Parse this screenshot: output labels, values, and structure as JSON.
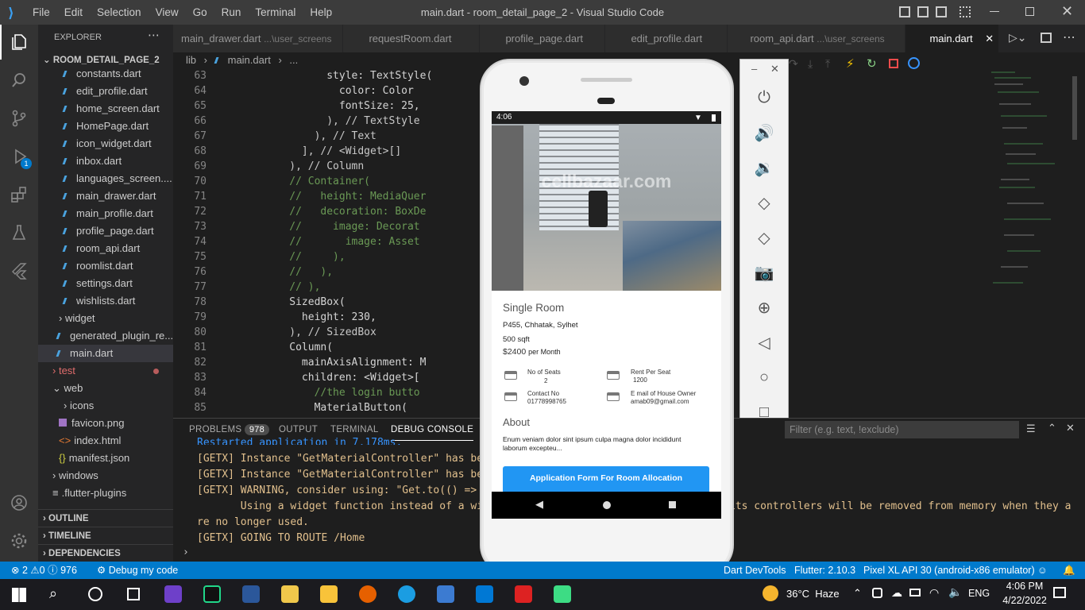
{
  "titlebar": {
    "title": "main.dart - room_detail_page_2 - Visual Studio Code",
    "menu": [
      "File",
      "Edit",
      "Selection",
      "View",
      "Go",
      "Run",
      "Terminal",
      "Help"
    ]
  },
  "activity": {
    "debug_badge": "1"
  },
  "explorer": {
    "header": "EXPLORER",
    "project": "ROOM_DETAIL_PAGE_2",
    "files": [
      "constants.dart",
      "edit_profile.dart",
      "home_screen.dart",
      "HomePage.dart",
      "icon_widget.dart",
      "inbox.dart",
      "languages_screen....",
      "main_drawer.dart",
      "main_profile.dart",
      "profile_page.dart",
      "room_api.dart",
      "roomlist.dart",
      "settings.dart",
      "wishlists.dart"
    ],
    "folder_widget": "widget",
    "generated": "generated_plugin_re...",
    "main": "main.dart",
    "test": "test",
    "web": "web",
    "icons": "icons",
    "favicon": "favicon.png",
    "index": "index.html",
    "manifest": "manifest.json",
    "windows": "windows",
    "flutter_plugins": ".flutter-plugins",
    "outline": "OUTLINE",
    "timeline": "TIMELINE",
    "dependencies": "DEPENDENCIES"
  },
  "tabs": [
    {
      "label": "main_drawer.dart",
      "hint": "...\\user_screens"
    },
    {
      "label": "requestRoom.dart",
      "hint": ""
    },
    {
      "label": "profile_page.dart",
      "hint": ""
    },
    {
      "label": "edit_profile.dart",
      "hint": ""
    },
    {
      "label": "room_api.dart",
      "hint": "...\\user_screens"
    },
    {
      "label": "main.dart",
      "hint": ""
    }
  ],
  "breadcrumb": {
    "a": "lib",
    "b": "main.dart",
    "c": "..."
  },
  "editor": {
    "line_numbers": [
      "63",
      "64",
      "65",
      "66",
      "67",
      "68",
      "69",
      "70",
      "71",
      "72",
      "73",
      "74",
      "75",
      "76",
      "77",
      "78",
      "79",
      "80",
      "81",
      "82",
      "83",
      "84",
      "85"
    ],
    "lines": [
      "                style: TextStyle(",
      "                  color: Color",
      "                  fontSize: 25,",
      "                ), // TextStyle",
      "              ), // Text",
      "            ], // <Widget>[]",
      "          ), // Column",
      "          // Container(",
      "          //   height: MediaQuer",
      "          //   decoration: BoxDe",
      "          //     image: Decorat",
      "          //       image: Asset",
      "          //     ),",
      "          //   ),",
      "          // ),",
      "          SizedBox(",
      "            height: 230,",
      "          ), // SizedBox",
      "          Column(",
      "            mainAxisAlignment: M",
      "            children: <Widget>[",
      "              //the login butto",
      "              MaterialButton("
    ]
  },
  "panel": {
    "problems": "PROBLEMS",
    "problems_count": "978",
    "output": "OUTPUT",
    "terminal": "TERMINAL",
    "debug_console": "DEBUG CONSOLE",
    "filter_placeholder": "Filter (e.g. text, !exclude)",
    "log_lines": [
      "Restarted application in 7,178ms.",
      "[GETX] Instance \"GetMaterialController\" has bee",
      "[GETX] Instance \"GetMaterialController\" has bee",
      "[GETX] WARNING, consider using: \"Get.to(() =>",
      "       Using a widget function instead of a wi",
      "re no longer used.",
      "[GETX] GOING TO ROUTE /Home"
    ],
    "log_tail": "its controllers will be removed from memory when they a"
  },
  "statusbar": {
    "errors": "2",
    "warnings": "0",
    "info": "976",
    "debug": "Debug my code",
    "devtools": "Dart DevTools",
    "flutter": "Flutter: 2.10.3",
    "device": "Pixel XL API 30 (android-x86 emulator)"
  },
  "taskbar": {
    "weather": "36°C  Haze",
    "lang": "ENG",
    "time": "4:06 PM",
    "date": "4/22/2022"
  },
  "phone": {
    "status_time": "4:06",
    "watermark": "cellbazaar.com",
    "room_title": "Single Room",
    "address": "P455, Chhatak, Sylhet",
    "size": "500 sqft",
    "price": "$2400",
    "price_unit": "per Month",
    "seats_label": "No of Seats",
    "seats_value": "2",
    "rent_label": "Rent Per Seat",
    "rent_value": "1200",
    "contact_label": "Contact No",
    "contact_value": "01778998765",
    "email_label": "E mail of House Owner",
    "email_value": "amab09@gmail.com",
    "about_title": "About",
    "about_text": "Enum veniam dolor sint ipsum culpa magna dolor incididunt laborum excepteu...",
    "button": "Application Form For Room Allocation"
  }
}
